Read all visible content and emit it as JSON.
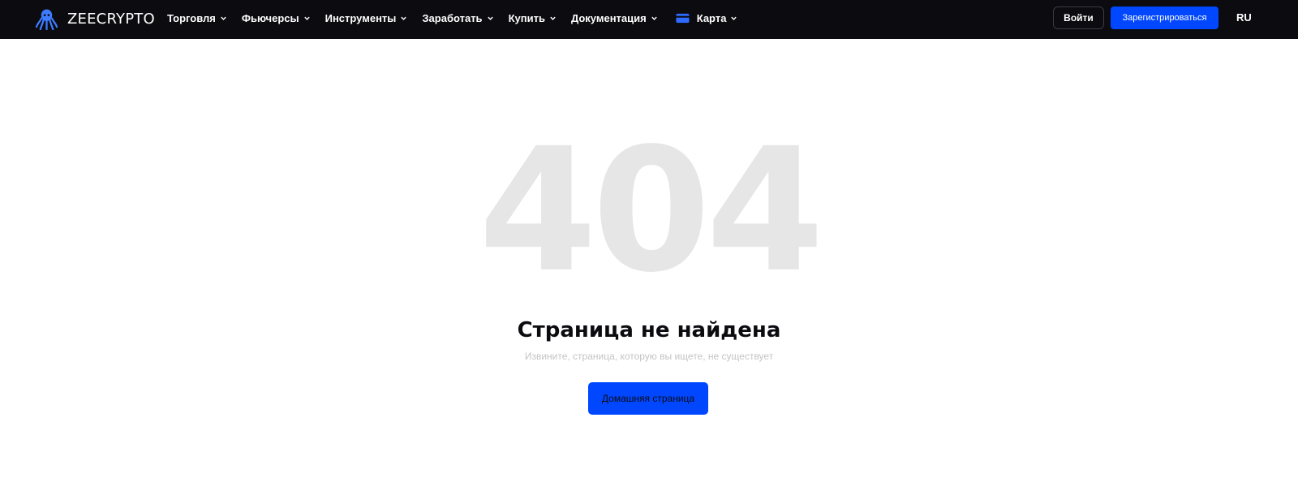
{
  "header": {
    "logo_text": "ZEECRYPTO",
    "nav": [
      {
        "label": "Торговля"
      },
      {
        "label": "Фьючерсы"
      },
      {
        "label": "Инструменты"
      },
      {
        "label": "Заработать"
      },
      {
        "label": "Купить"
      },
      {
        "label": "Документация"
      },
      {
        "label": "Карта"
      }
    ],
    "login_label": "Войти",
    "register_label": "Зарегистрироваться",
    "language": "RU"
  },
  "main": {
    "code": "404",
    "title": "Страница не найдена",
    "subtitle": "Извините, страница, которую вы ищете, не существует",
    "home_button": "Домашняя страница"
  },
  "icons": {
    "logo": "octopus-logo-icon",
    "chevron": "chevron-down-icon",
    "card": "credit-card-icon"
  },
  "colors": {
    "header_bg": "#0b0b10",
    "accent": "#0047ff",
    "logo_blue": "#3d7bff",
    "big_code": "#e6e6e6",
    "subtitle": "#c4c4c4"
  }
}
